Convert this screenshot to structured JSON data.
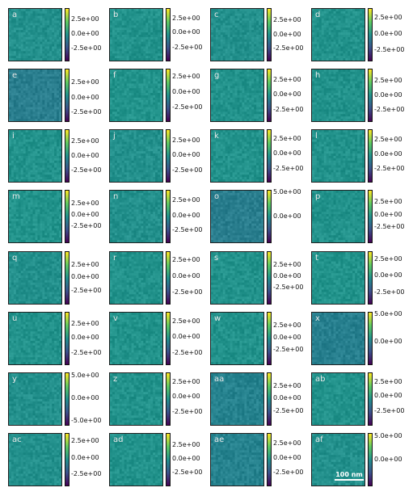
{
  "colors": {
    "background": "#ffffff",
    "label_text": "#e8e8e8",
    "colormap": [
      "#440154",
      "#3b528b",
      "#21918c",
      "#5ec962",
      "#fde725"
    ]
  },
  "scale_bar": {
    "label": "100 nm",
    "panel": "af"
  },
  "panels": [
    {
      "label": "a",
      "tint": "#23908c",
      "ticks": [
        "2.5e+00",
        "0.0e+00",
        "-2.5e+00"
      ],
      "tick_levels": [
        0.78,
        0.5,
        0.22
      ]
    },
    {
      "label": "b",
      "tint": "#22928b",
      "ticks": [
        "2.5e+00",
        "0.0e+00",
        "-2.5e+00"
      ],
      "tick_levels": [
        0.8,
        0.53,
        0.24
      ]
    },
    {
      "label": "c",
      "tint": "#23908c",
      "ticks": [
        "2.5e+00",
        "0.0e+00",
        "-2.5e+00"
      ],
      "tick_levels": [
        0.76,
        0.49,
        0.22
      ]
    },
    {
      "label": "d",
      "tint": "#22928b",
      "ticks": [
        "2.5e+00",
        "0.0e+00",
        "-2.5e+00"
      ],
      "tick_levels": [
        0.81,
        0.5,
        0.18
      ]
    },
    {
      "label": "e",
      "tint": "#2a7e8e",
      "ticks": [
        "2.5e+00",
        "0.0e+00",
        "-2.5e+00"
      ],
      "tick_levels": [
        0.74,
        0.44,
        0.15
      ]
    },
    {
      "label": "f",
      "tint": "#22938b",
      "ticks": [
        "2.5e+00",
        "0.0e+00",
        "-2.5e+00"
      ],
      "tick_levels": [
        0.84,
        0.55,
        0.25
      ]
    },
    {
      "label": "g",
      "tint": "#22928b",
      "ticks": [
        "2.5e+00",
        "0.0e+00",
        "-2.5e+00"
      ],
      "tick_levels": [
        0.78,
        0.5,
        0.21
      ]
    },
    {
      "label": "h",
      "tint": "#22928b",
      "ticks": [
        "2.5e+00",
        "0.0e+00",
        "-2.5e+00"
      ],
      "tick_levels": [
        0.77,
        0.49,
        0.2
      ]
    },
    {
      "label": "i",
      "tint": "#22928b",
      "ticks": [
        "2.5e+00",
        "0.0e+00",
        "-2.5e+00"
      ],
      "tick_levels": [
        0.77,
        0.49,
        0.21
      ]
    },
    {
      "label": "j",
      "tint": "#23908c",
      "ticks": [
        "2.5e+00",
        "0.0e+00",
        "-2.5e+00"
      ],
      "tick_levels": [
        0.78,
        0.5,
        0.21
      ]
    },
    {
      "label": "k",
      "tint": "#22928b",
      "ticks": [
        "2.5e+00",
        "0.0e+00",
        "-2.5e+00"
      ],
      "tick_levels": [
        0.82,
        0.53,
        0.24
      ]
    },
    {
      "label": "l",
      "tint": "#22928b",
      "ticks": [
        "2.5e+00",
        "0.0e+00",
        "-2.5e+00"
      ],
      "tick_levels": [
        0.79,
        0.52,
        0.24
      ]
    },
    {
      "label": "m",
      "tint": "#22938b",
      "ticks": [
        "2.5e+00",
        "0.0e+00",
        "-2.5e+00"
      ],
      "tick_levels": [
        0.74,
        0.52,
        0.3
      ]
    },
    {
      "label": "n",
      "tint": "#23908c",
      "ticks": [
        "2.5e+00",
        "0.0e+00",
        "-2.5e+00"
      ],
      "tick_levels": [
        0.79,
        0.5,
        0.22
      ]
    },
    {
      "label": "o",
      "tint": "#2a7e8e",
      "ticks": [
        "5.0e+00",
        "0.0e+00"
      ],
      "tick_levels": [
        0.95,
        0.48
      ]
    },
    {
      "label": "p",
      "tint": "#22928b",
      "ticks": [
        "2.5e+00",
        "0.0e+00",
        "-2.5e+00"
      ],
      "tick_levels": [
        0.77,
        0.52,
        0.28
      ]
    },
    {
      "label": "q",
      "tint": "#23908c",
      "ticks": [
        "2.5e+00",
        "0.0e+00",
        "-2.5e+00"
      ],
      "tick_levels": [
        0.74,
        0.5,
        0.24
      ]
    },
    {
      "label": "r",
      "tint": "#22928b",
      "ticks": [
        "2.5e+00",
        "0.0e+00",
        "-2.5e+00"
      ],
      "tick_levels": [
        0.83,
        0.52,
        0.21
      ]
    },
    {
      "label": "s",
      "tint": "#22928b",
      "ticks": [
        "2.5e+00",
        "0.0e+00",
        "-2.5e+00"
      ],
      "tick_levels": [
        0.74,
        0.52,
        0.29
      ]
    },
    {
      "label": "t",
      "tint": "#22938b",
      "ticks": [
        "2.5e+00",
        "0.0e+00",
        "-2.5e+00"
      ],
      "tick_levels": [
        0.84,
        0.53,
        0.21
      ]
    },
    {
      "label": "u",
      "tint": "#22928b",
      "ticks": [
        "2.5e+00",
        "0.0e+00",
        "-2.5e+00"
      ],
      "tick_levels": [
        0.77,
        0.5,
        0.21
      ]
    },
    {
      "label": "v",
      "tint": "#22938b",
      "ticks": [
        "2.5e+00",
        "0.0e+00",
        "-2.5e+00"
      ],
      "tick_levels": [
        0.81,
        0.52,
        0.21
      ]
    },
    {
      "label": "w",
      "tint": "#22928b",
      "ticks": [
        "2.5e+00",
        "0.0e+00",
        "-2.5e+00"
      ],
      "tick_levels": [
        0.74,
        0.5,
        0.27
      ]
    },
    {
      "label": "x",
      "tint": "#277f8e",
      "ticks": [
        "5.0e+00",
        "0.0e+00"
      ],
      "tick_levels": [
        0.95,
        0.42
      ]
    },
    {
      "label": "y",
      "tint": "#23908c",
      "ticks": [
        "5.0e+00",
        "0.0e+00",
        "-5.0e+00"
      ],
      "tick_levels": [
        0.94,
        0.5,
        0.06
      ]
    },
    {
      "label": "z",
      "tint": "#22928b",
      "ticks": [
        "2.5e+00",
        "0.0e+00",
        "-2.5e+00"
      ],
      "tick_levels": [
        0.82,
        0.53,
        0.24
      ]
    },
    {
      "label": "aa",
      "tint": "#26828e",
      "ticks": [
        "2.5e+00",
        "0.0e+00",
        "-2.5e+00"
      ],
      "tick_levels": [
        0.74,
        0.5,
        0.25
      ]
    },
    {
      "label": "ab",
      "tint": "#22928b",
      "ticks": [
        "2.5e+00",
        "0.0e+00",
        "-2.5e+00"
      ],
      "tick_levels": [
        0.82,
        0.55,
        0.25
      ]
    },
    {
      "label": "ac",
      "tint": "#23908c",
      "ticks": [
        "2.5e+00",
        "0.0e+00",
        "-2.5e+00"
      ],
      "tick_levels": [
        0.84,
        0.52,
        0.2
      ]
    },
    {
      "label": "ad",
      "tint": "#22928b",
      "ticks": [
        "2.5e+00",
        "0.0e+00",
        "-2.5e+00"
      ],
      "tick_levels": [
        0.76,
        0.5,
        0.23
      ]
    },
    {
      "label": "ae",
      "tint": "#26828e",
      "ticks": [
        "2.5e+00",
        "0.0e+00",
        "-2.5e+00"
      ],
      "tick_levels": [
        0.8,
        0.52,
        0.24
      ]
    },
    {
      "label": "af",
      "tint": "#23908c",
      "ticks": [
        "5.0e+00",
        "0.0e+00"
      ],
      "tick_levels": [
        0.94,
        0.48
      ]
    }
  ]
}
